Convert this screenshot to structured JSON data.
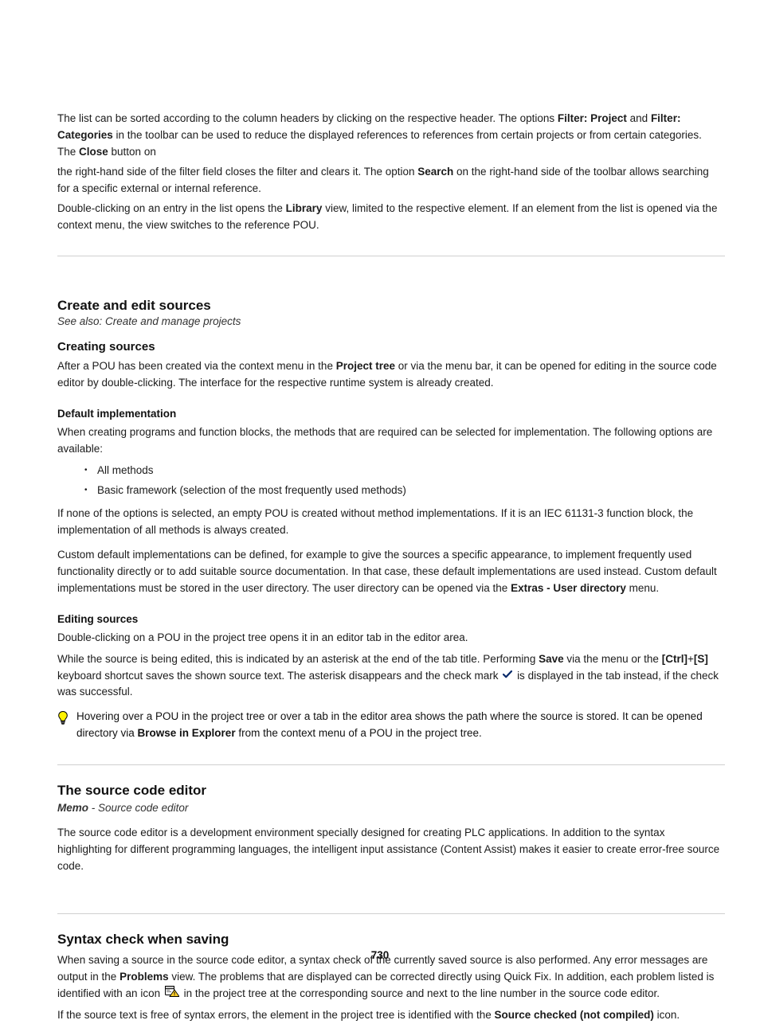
{
  "intro": {
    "line1_pre": "The list can be sorted according to the column headers by clicking on the respective header. The options ",
    "line1_kw1": "Filter: Project",
    "line1_mid": " and ",
    "line1_kw2": "Filter: Categories",
    "line1_post": " in the toolbar can be used to reduce the displayed references to references from certain projects or from certain categories. The ",
    "line1_kw3": "Close",
    "line1_on": " button on",
    "line2_pre": "the right-hand side of the filter field closes the filter and clears it. The option ",
    "line2_kw": "Search",
    "line2_post": " on the right-hand side of the toolbar allows searching for a specific external or internal reference.",
    "line3_pre": "Double-clicking on an entry in the list opens the ",
    "line3_kw": "Library",
    "line3_post": " view, limited to the respective element. If an element from the list is opened via the context menu, the view switches to the reference POU."
  },
  "section1": {
    "title": "Create and edit sources",
    "seealso1": "See also: Create and manage projects",
    "h_create": "Creating sources",
    "p_create_pre": "After a POU has been created via the context menu in the ",
    "p_create_kw": "Project tree",
    "p_create_post": " or via the menu bar, it can be opened for editing in the source code editor by double-clicking. The interface for the respective runtime system is already created.",
    "h_defaultimpl": "Default implementation",
    "p_defaultimpl": "When creating programs and function blocks, the methods that are required can be selected for implementation. The following options are available:",
    "bullets": {
      "b1": "All methods",
      "b2": "Basic framework (selection of the most frequently used methods)"
    },
    "p_bullets_post": "If none of the options is selected, an empty POU is created without method implementations. If it is an IEC 61131-3 function block, the implementation of all methods is always created.",
    "p_custom_pre": "Custom default implementations can be defined, for example to give the sources a specific appearance, to implement frequently used functionality directly or to add suitable source documentation. In that case, these default implementations are used instead. Custom default implementations must be stored in the user directory. The user directory can be opened via the ",
    "p_custom_kw": "Extras - User directory",
    "p_custom_post": " menu.",
    "h_editing": "Editing sources",
    "p_open": "Double-clicking on a POU in the project tree opens it in an editor tab in the editor area.",
    "p_dirty_pre": "While the source is being edited, this is indicated by an asterisk at the end of the tab title. Performing ",
    "p_dirty_kw": "Save",
    "p_dirty_mid": " via the menu or the ",
    "p_dirty_sc1": "[Ctrl]",
    "p_dirty_plus": "+",
    "p_dirty_sc2": "[S]",
    "p_dirty_post": " keyboard shortcut saves the shown source text. The asterisk disappears and the check mark ",
    "p_dirty_end": " is displayed in the tab instead, if the check was successful.",
    "tip_pre": "Hovering over a POU in the project tree or over a tab in the editor area shows the path where the source is stored. It can be opened directory via ",
    "tip_kw": "Browse in Explorer",
    "tip_post": " from the context menu of a POU in the project tree."
  },
  "section2": {
    "title": "The source code editor",
    "sub_label": "Memo",
    "sub_text": " - Source code editor",
    "p": "The source code editor is a development environment specially designed for creating PLC applications. In addition to the syntax highlighting for different programming languages, the intelligent input assistance (Content Assist) makes it easier to create error-free source code."
  },
  "section3": {
    "title": "Syntax check when saving",
    "p1_pre": "When saving a source in the source code editor, a syntax check of the currently saved source is also performed. Any error messages are output in the ",
    "p1_kw": "Problems",
    "p1_post": " view. The problems that are displayed can be corrected directly using Quick Fix. In addition, each problem listed is identified with an icon ",
    "p1_end": " in the project tree at the corresponding source and next to the line number in the source code editor.",
    "p2_pre": "If the source text is free of syntax errors, the element in the project tree is identified with the ",
    "p2_kw": "Source checked (not compiled)",
    "p2_post": " icon."
  },
  "pagenum": "730"
}
